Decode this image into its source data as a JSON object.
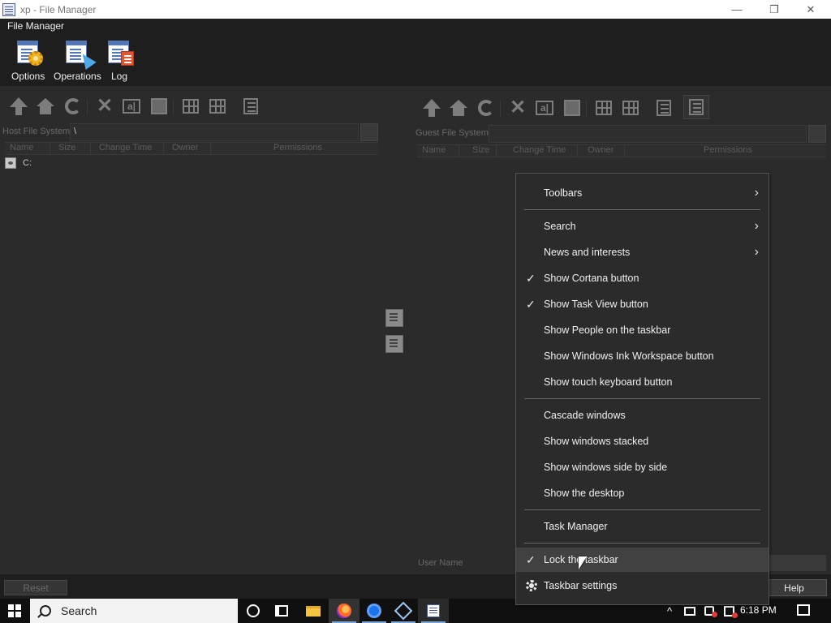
{
  "window": {
    "title": "xp - File Manager",
    "controls": {
      "minimize": "—",
      "restore": "❐",
      "close": "✕"
    }
  },
  "menubar": {
    "items": [
      "File Manager"
    ]
  },
  "main_toolbar": {
    "buttons": [
      {
        "label": "Options",
        "icon": "options-icon"
      },
      {
        "label": "Operations",
        "icon": "operations-icon"
      },
      {
        "label": "Log",
        "icon": "log-icon"
      }
    ]
  },
  "host_pane": {
    "path_label": "Host File System:",
    "path_value": "\\",
    "columns": [
      "Name",
      "Size",
      "Change Time",
      "Owner",
      "Permissions"
    ],
    "files": [
      {
        "name": "C:",
        "icon": "drive-icon"
      }
    ]
  },
  "guest_pane": {
    "path_label": "Guest File System:",
    "path_value": "",
    "columns": [
      "Name",
      "Size",
      "Change Time",
      "Owner",
      "Permissions"
    ],
    "user_name_label": "User Name"
  },
  "bottom": {
    "reset_label": "Reset",
    "help_label": "Help"
  },
  "context_menu": {
    "items": [
      {
        "label": "Toolbars",
        "submenu": true,
        "checked": false
      },
      {
        "label": "Search",
        "submenu": true,
        "checked": false
      },
      {
        "label": "News and interests",
        "submenu": true,
        "checked": false
      },
      {
        "label": "Show Cortana button",
        "submenu": false,
        "checked": true
      },
      {
        "label": "Show Task View button",
        "submenu": false,
        "checked": true
      },
      {
        "label": "Show People on the taskbar",
        "submenu": false,
        "checked": false
      },
      {
        "label": "Show Windows Ink Workspace button",
        "submenu": false,
        "checked": false
      },
      {
        "label": "Show touch keyboard button",
        "submenu": false,
        "checked": false
      },
      {
        "label": "Cascade windows",
        "submenu": false,
        "checked": false
      },
      {
        "label": "Show windows stacked",
        "submenu": false,
        "checked": false
      },
      {
        "label": "Show windows side by side",
        "submenu": false,
        "checked": false
      },
      {
        "label": "Show the desktop",
        "submenu": false,
        "checked": false
      },
      {
        "label": "Task Manager",
        "submenu": false,
        "checked": false
      },
      {
        "label": "Lock the taskbar",
        "submenu": false,
        "checked": true,
        "hovered": true
      },
      {
        "label": "Taskbar settings",
        "submenu": false,
        "checked": false,
        "icon": "gear-icon"
      }
    ],
    "check_glyph": "✓",
    "arrow_glyph": "›"
  },
  "taskbar": {
    "search_placeholder": "Search",
    "clock": "6:18 PM",
    "pinned": [
      "cortana-icon",
      "task-view-icon",
      "file-explorer-icon",
      "firefox-icon",
      "chrome-icon",
      "virtualbox-icon",
      "file-manager-icon"
    ],
    "tray_chevron": "^"
  }
}
